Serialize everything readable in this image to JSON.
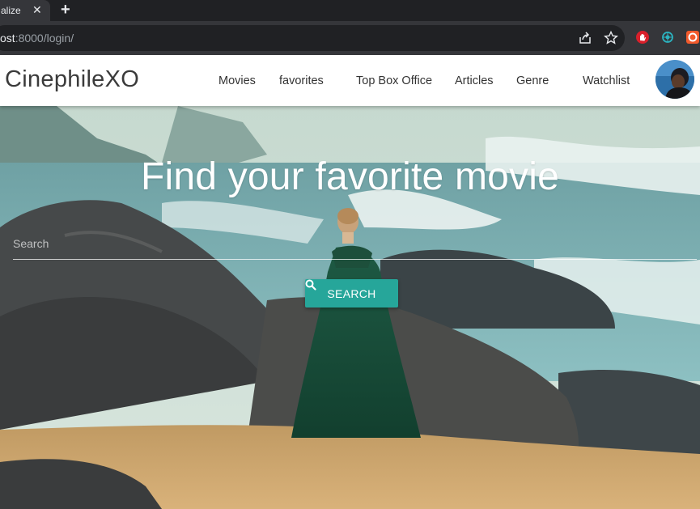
{
  "browser": {
    "tab_title": "alize",
    "tab_close": "✕",
    "new_tab": "+",
    "url_prefix": "ost",
    "url_rest": ":8000/login/"
  },
  "navbar": {
    "brand": "CinephileXO",
    "items": [
      "Movies",
      "favorites",
      "Top Box Office",
      "Articles",
      "Genre",
      "Watchlist"
    ]
  },
  "hero": {
    "title": "Find your favorite movie",
    "search_placeholder": "Search",
    "search_button": "SEARCH"
  },
  "colors": {
    "accent": "#26a69a",
    "navbar_bg": "#ffffff",
    "chrome_bg": "#35363a"
  },
  "icons": [
    "close-icon",
    "new-tab-icon",
    "share-icon",
    "star-icon",
    "adblock-icon",
    "extension-icon",
    "brave-icon",
    "search-icon",
    "avatar"
  ]
}
